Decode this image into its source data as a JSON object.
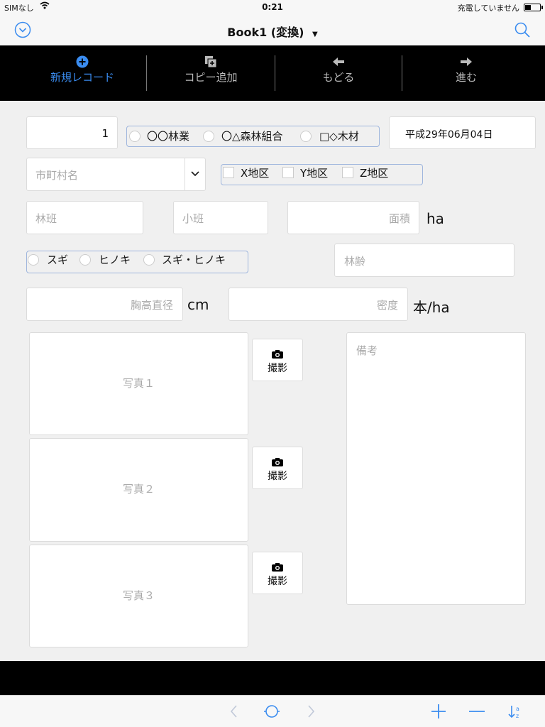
{
  "status": {
    "carrier": "SIMなし",
    "time": "0:21",
    "charge": "充電していません"
  },
  "nav": {
    "title": "Book1 (変換)"
  },
  "toolbar": {
    "items": [
      {
        "label": "新規レコード",
        "icon": "plus-circle-icon"
      },
      {
        "label": "コピー追加",
        "icon": "copy-add-icon"
      },
      {
        "label": "もどる",
        "icon": "arrow-left-icon"
      },
      {
        "label": "進む",
        "icon": "arrow-right-icon"
      }
    ]
  },
  "form": {
    "record_no": "1",
    "companies": [
      "〇〇林業",
      "〇△森林組合",
      "□◇木材"
    ],
    "date": "平成29年06月04日",
    "municipality_placeholder": "市町村名",
    "districts": [
      "X地区",
      "Y地区",
      "Z地区"
    ],
    "rinpan_placeholder": "林班",
    "shohan_placeholder": "小班",
    "area_placeholder": "面積",
    "area_unit": "ha",
    "species": [
      "スギ",
      "ヒノキ",
      "スギ・ヒノキ"
    ],
    "age_placeholder": "林齢",
    "dbh_placeholder": "胸高直径",
    "dbh_unit": "cm",
    "density_placeholder": "密度",
    "density_unit": "本/ha",
    "photos": [
      "写真１",
      "写真２",
      "写真３"
    ],
    "shoot_label": "撮影",
    "notes_placeholder": "備考"
  },
  "colors": {
    "accent": "#3a8cf0",
    "toolbar_bg": "#000000",
    "group_border": "#9fb6dd"
  }
}
